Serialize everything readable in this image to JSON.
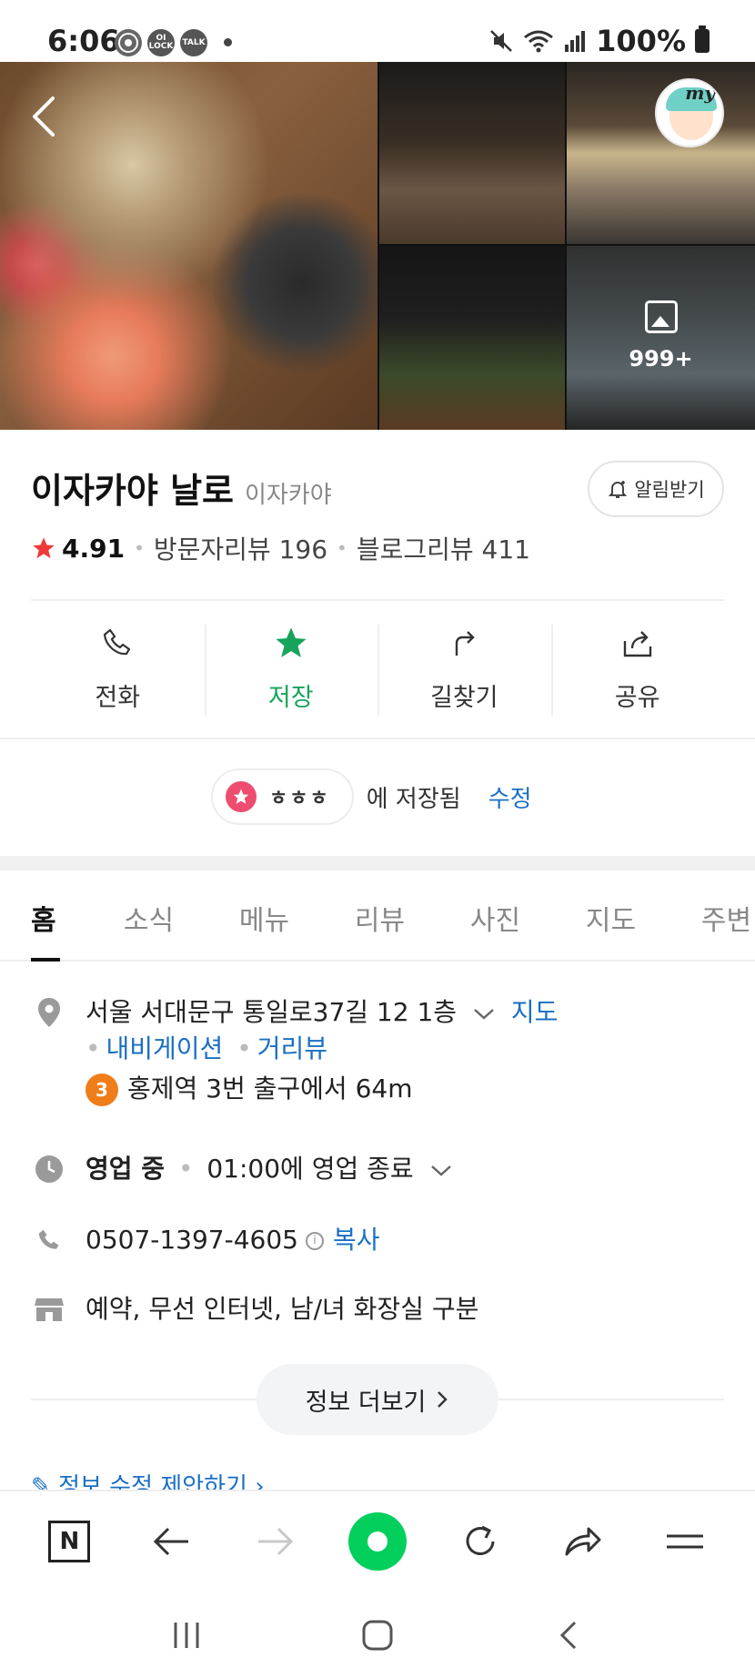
{
  "status_bar": {
    "time": "6:06",
    "icons": [
      "chrome-icon",
      "lock-icon",
      "talk-icon"
    ],
    "lock_label": "OI LOCK",
    "talk_label": "TALK",
    "battery": "100%"
  },
  "gallery": {
    "more_count": "999+",
    "avatar_text": "my"
  },
  "place": {
    "name": "이자카야 날로",
    "category": "이자카야",
    "notify_label": "알림받기",
    "rating": "4.91",
    "visitor_reviews": "방문자리뷰 196",
    "blog_reviews": "블로그리뷰 411"
  },
  "actions": [
    {
      "label": "전화",
      "icon": "phone-icon"
    },
    {
      "label": "저장",
      "icon": "star-icon"
    },
    {
      "label": "길찾기",
      "icon": "directions-icon"
    },
    {
      "label": "공유",
      "icon": "share-icon"
    }
  ],
  "saved": {
    "list_name": "ㅎㅎㅎ",
    "text": "에 저장됨",
    "edit": "수정"
  },
  "tabs": [
    "홈",
    "소식",
    "메뉴",
    "리뷰",
    "사진",
    "지도",
    "주변"
  ],
  "info": {
    "address": "서울 서대문구 통일로37길 12 1층",
    "map_link": "지도",
    "navigation_link": "내비게이션",
    "streetview_link": "거리뷰",
    "subway_line": "3",
    "subway_text": "홍제역 3번 출구에서 64m",
    "hours_status": "영업 중",
    "hours_text": "01:00에 영업 종료",
    "phone": "0507-1397-4605",
    "copy": "복사",
    "amenities": "예약, 무선 인터넷, 남/녀 화장실 구분",
    "more_info": "정보 더보기",
    "suggest_edit": "정보 수정 제안하기"
  },
  "colors": {
    "accent_green": "#03cf5d",
    "save_green": "#17a45a",
    "link_blue": "#1a6fc4",
    "rating_red": "#ef3a3a",
    "subway_orange": "#ef7d1a"
  }
}
